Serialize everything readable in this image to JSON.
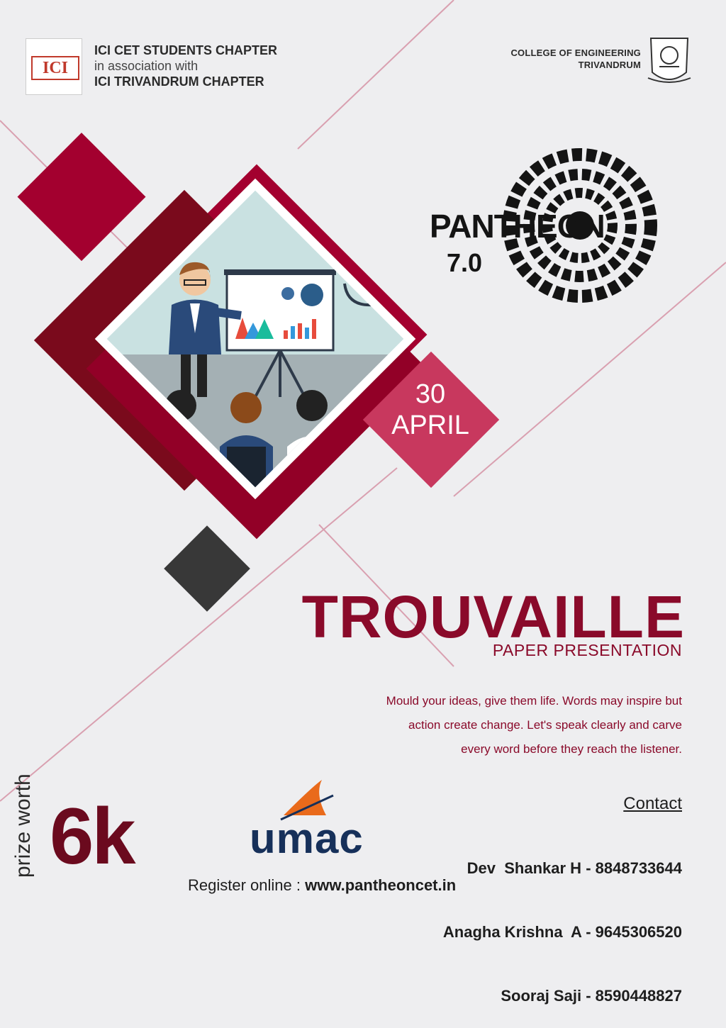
{
  "header": {
    "org_line1": "ICI CET STUDENTS CHAPTER",
    "org_line2": "in association with",
    "org_line3": "ICI TRIVANDRUM CHAPTER",
    "logo_text": "ICI",
    "college_line1": "COLLEGE OF ENGINEERING",
    "college_line2": "TRIVANDRUM"
  },
  "event": {
    "fest_name": "PANTHEON",
    "fest_version": "7.0",
    "date_day": "30",
    "date_month": "APRIL",
    "title": "TROUVAILLE",
    "subtitle": "PAPER PRESENTATION",
    "desc_line1": "Mould your ideas, give them life. Words may inspire but",
    "desc_line2": "action create change. Let's speak clearly and carve",
    "desc_line3": "every word before they reach the listener."
  },
  "prize": {
    "label": "prize worth",
    "value": "6k"
  },
  "sponsor": {
    "name": "umac"
  },
  "register": {
    "label": "Register online : ",
    "url": "www.pantheoncet.in"
  },
  "contact": {
    "heading": "Contact",
    "people": [
      {
        "name": "Dev  Shankar H",
        "phone": "8848733644"
      },
      {
        "name": "Anagha Krishna  A",
        "phone": "9645306520"
      },
      {
        "name": "Sooraj Saji",
        "phone": "8590448827"
      }
    ]
  },
  "colors": {
    "crimson": "#a3002f",
    "dark_red": "#6b0a1e",
    "pink": "#c8385e",
    "dark_gray": "#383838",
    "navy": "#16305a",
    "orange": "#e96a1b",
    "background": "#eeeef0"
  },
  "icons": [
    "ici-logo-icon",
    "college-emblem-icon",
    "pantheon-logo-icon",
    "presentation-illustration-icon",
    "umac-rocket-icon"
  ]
}
